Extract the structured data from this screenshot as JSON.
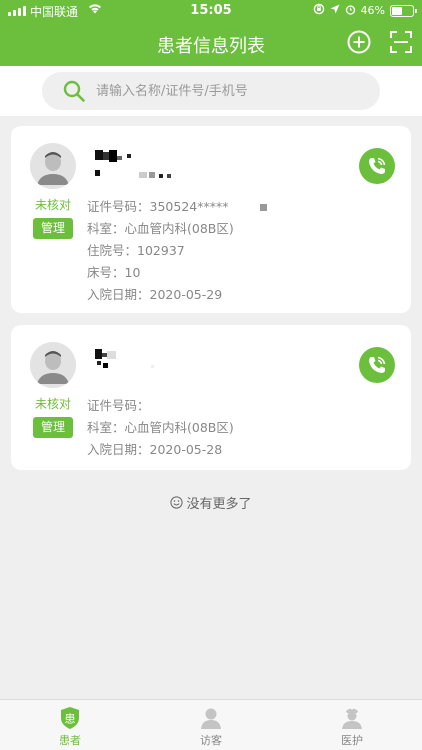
{
  "status_bar": {
    "carrier": "中国联通",
    "time": "15:05",
    "battery": "46%"
  },
  "header": {
    "title": "患者信息列表",
    "add_icon": "plus-circle-icon",
    "scan_icon": "scan-icon"
  },
  "search": {
    "placeholder": "请输入名称/证件号/手机号",
    "icon": "search-icon"
  },
  "patients": [
    {
      "status": "未核对",
      "manage_label": "管理",
      "id_label": "证件号码：",
      "id_value": "350524*****",
      "dept_label": "科室：",
      "dept_value": "心血管内科(08B区)",
      "admission_label": "住院号：",
      "admission_value": "102937",
      "bed_label": "床号：",
      "bed_value": "10",
      "date_label": "入院日期：",
      "date_value": "2020-05-29"
    },
    {
      "status": "未核对",
      "manage_label": "管理",
      "id_label": "证件号码：",
      "id_value": "",
      "dept_label": "科室：",
      "dept_value": "心血管内科(08B区)",
      "date_label": "入院日期：",
      "date_value": "2020-05-28"
    }
  ],
  "list_footer": "没有更多了",
  "tabs": [
    {
      "label": "患者",
      "icon": "patient-icon",
      "active": true
    },
    {
      "label": "访客",
      "icon": "visitor-icon",
      "active": false
    },
    {
      "label": "医护",
      "icon": "medical-staff-icon",
      "active": false
    }
  ],
  "colors": {
    "brand_green": "#6cbf3c",
    "background": "#efefef"
  }
}
